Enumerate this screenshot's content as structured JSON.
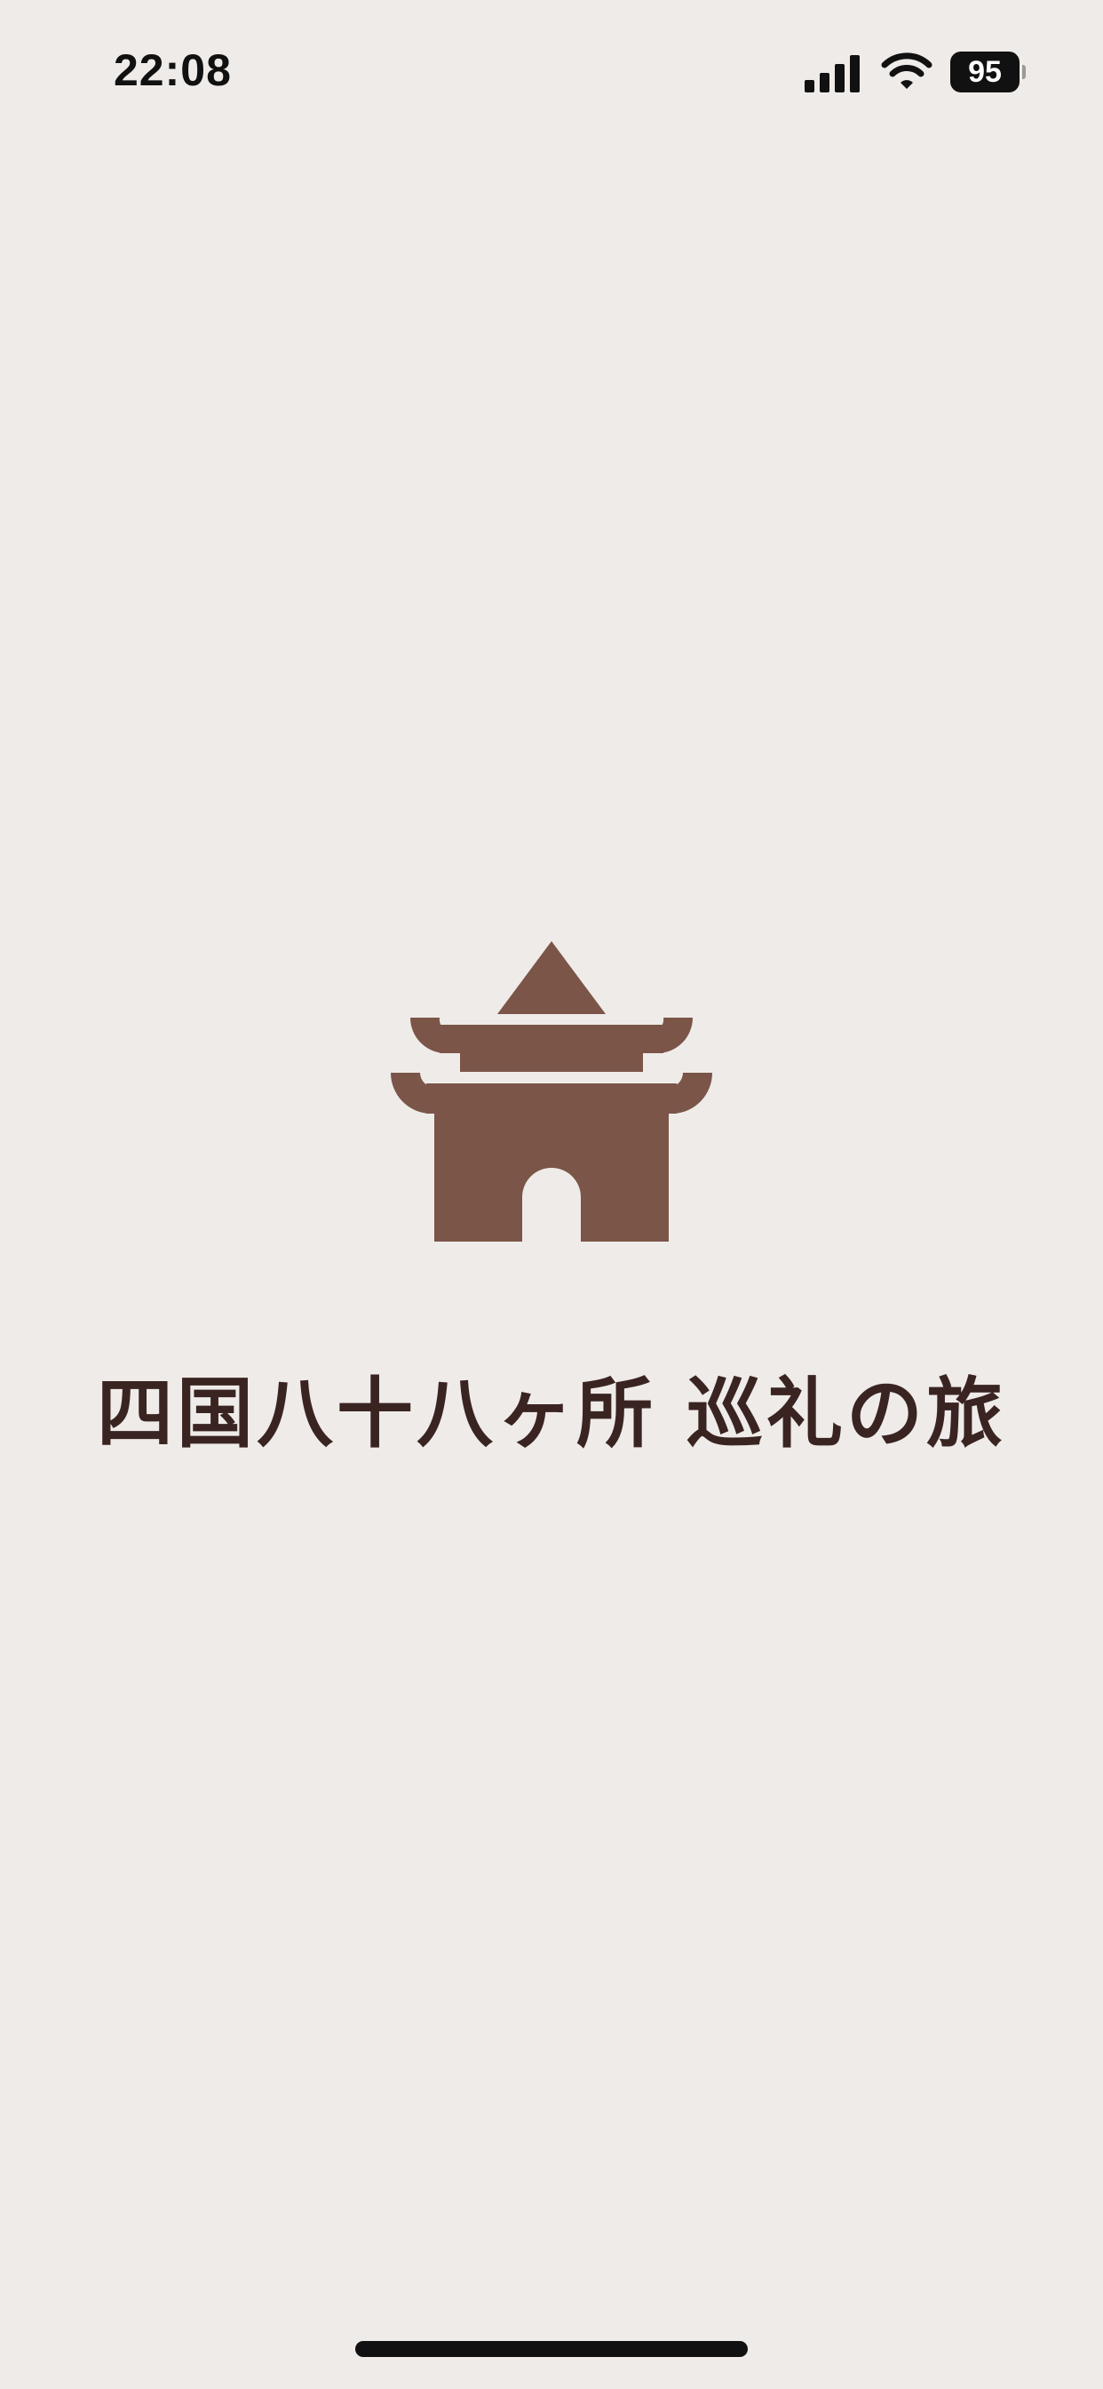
{
  "status_bar": {
    "time": "22:08",
    "battery_level": "95",
    "icons": [
      "signal-icon",
      "wifi-icon",
      "battery-icon"
    ]
  },
  "splash": {
    "logo_icon": "temple-gate-icon",
    "title": "四国八十八ヶ所 巡礼の旅"
  },
  "colors": {
    "background": "#efebe8",
    "logo": "#7b5548",
    "title": "#3a2422",
    "status_text": "#111111"
  }
}
